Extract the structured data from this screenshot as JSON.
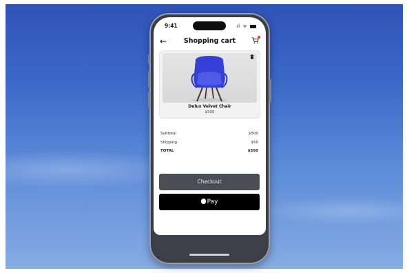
{
  "status_bar": {
    "time": "9:41",
    "signal_glyph": "ıl",
    "wifi_glyph": "ᯤ"
  },
  "nav": {
    "back_glyph": "←",
    "title": "Shopping cart",
    "cart_glyph": "🛒"
  },
  "product": {
    "name": "Delux Velvet Chair",
    "price": "$500",
    "trash_glyph": "🗑",
    "chair_color": "#3a46d8"
  },
  "summary": {
    "rows": [
      {
        "label": "Subtotal",
        "value": "$500"
      },
      {
        "label": "Shipping",
        "value": "$50"
      },
      {
        "label": "TOTAL",
        "value": "$550"
      }
    ]
  },
  "buttons": {
    "checkout": "Checkout",
    "apple_pay": "Pay"
  },
  "icons": [
    "back-arrow-icon",
    "cart-icon",
    "trash-icon",
    "apple-icon",
    "signal-icon",
    "wifi-icon",
    "battery-icon"
  ]
}
